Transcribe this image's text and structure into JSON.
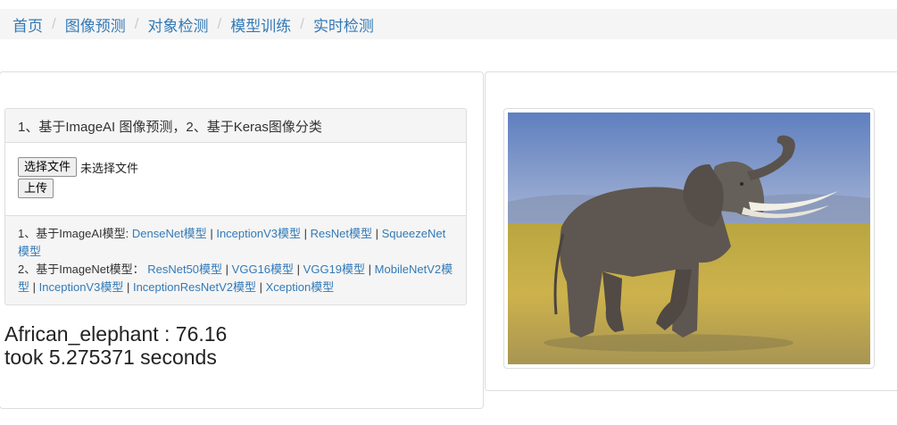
{
  "nav": {
    "items": [
      {
        "label": "首页"
      },
      {
        "label": "图像预测"
      },
      {
        "label": "对象检测"
      },
      {
        "label": "模型训练"
      },
      {
        "label": "实时检测"
      }
    ],
    "separator": "/"
  },
  "upload_card": {
    "heading": "1、基于ImageAI 图像预测，2、基于Keras图像分类",
    "choose_file_label": "选择文件",
    "no_file_text": "未选择文件",
    "upload_label": "上传"
  },
  "models": {
    "imageai_prefix": "1、基于ImageAI模型: ",
    "imagenet_prefix": "2、基于ImageNet模型：",
    "divider": "|",
    "imageai": [
      "DenseNet模型",
      "InceptionV3模型",
      "ResNet模型",
      "SqueezeNet模型"
    ],
    "imagenet": [
      "ResNet50模型",
      "VGG16模型",
      "VGG19模型",
      "MobileNetV2模型",
      "InceptionV3模型",
      "InceptionResNetV2模型",
      "Xception模型"
    ]
  },
  "result": {
    "prediction": "African_elephant : 76.16",
    "timing": "took 5.275371 seconds"
  },
  "image": {
    "subject": "elephant-photo",
    "colors": {
      "sky": "#7d96c9",
      "grass": "#c9b04a",
      "elephant": "#5e5650",
      "tusk": "#f2efe6"
    }
  }
}
